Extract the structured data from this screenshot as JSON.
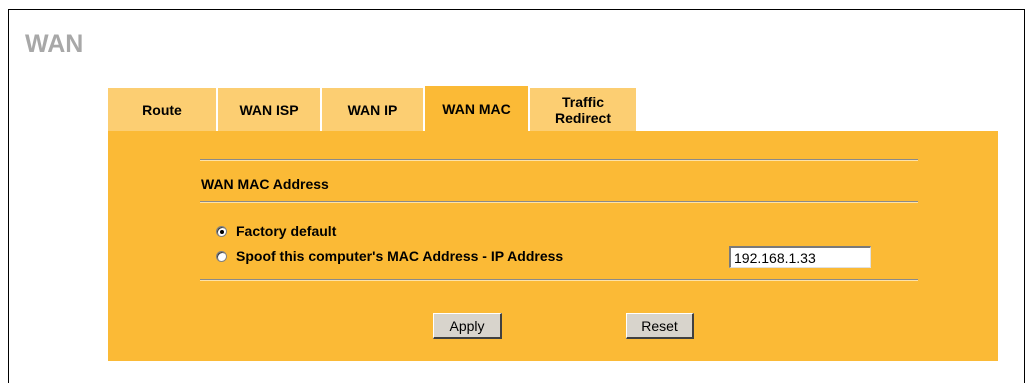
{
  "page": {
    "title": "WAN"
  },
  "tabs": [
    {
      "label": "Route",
      "active": false
    },
    {
      "label": "WAN ISP",
      "active": false
    },
    {
      "label": "WAN IP",
      "active": false
    },
    {
      "label": "WAN MAC",
      "active": true
    },
    {
      "label": "Traffic\nRedirect",
      "active": false
    }
  ],
  "section": {
    "heading": "WAN MAC Address"
  },
  "options": {
    "factory_default": {
      "label": "Factory default",
      "selected": true
    },
    "spoof": {
      "label": "Spoof this computer's MAC Address - IP Address",
      "selected": false
    }
  },
  "ip_address": {
    "value": "192.168.1.33"
  },
  "buttons": {
    "apply": "Apply",
    "reset": "Reset"
  },
  "colors": {
    "panel": "#fbba36",
    "tab_inactive": "#fcce72",
    "title": "#a8a8a8"
  }
}
